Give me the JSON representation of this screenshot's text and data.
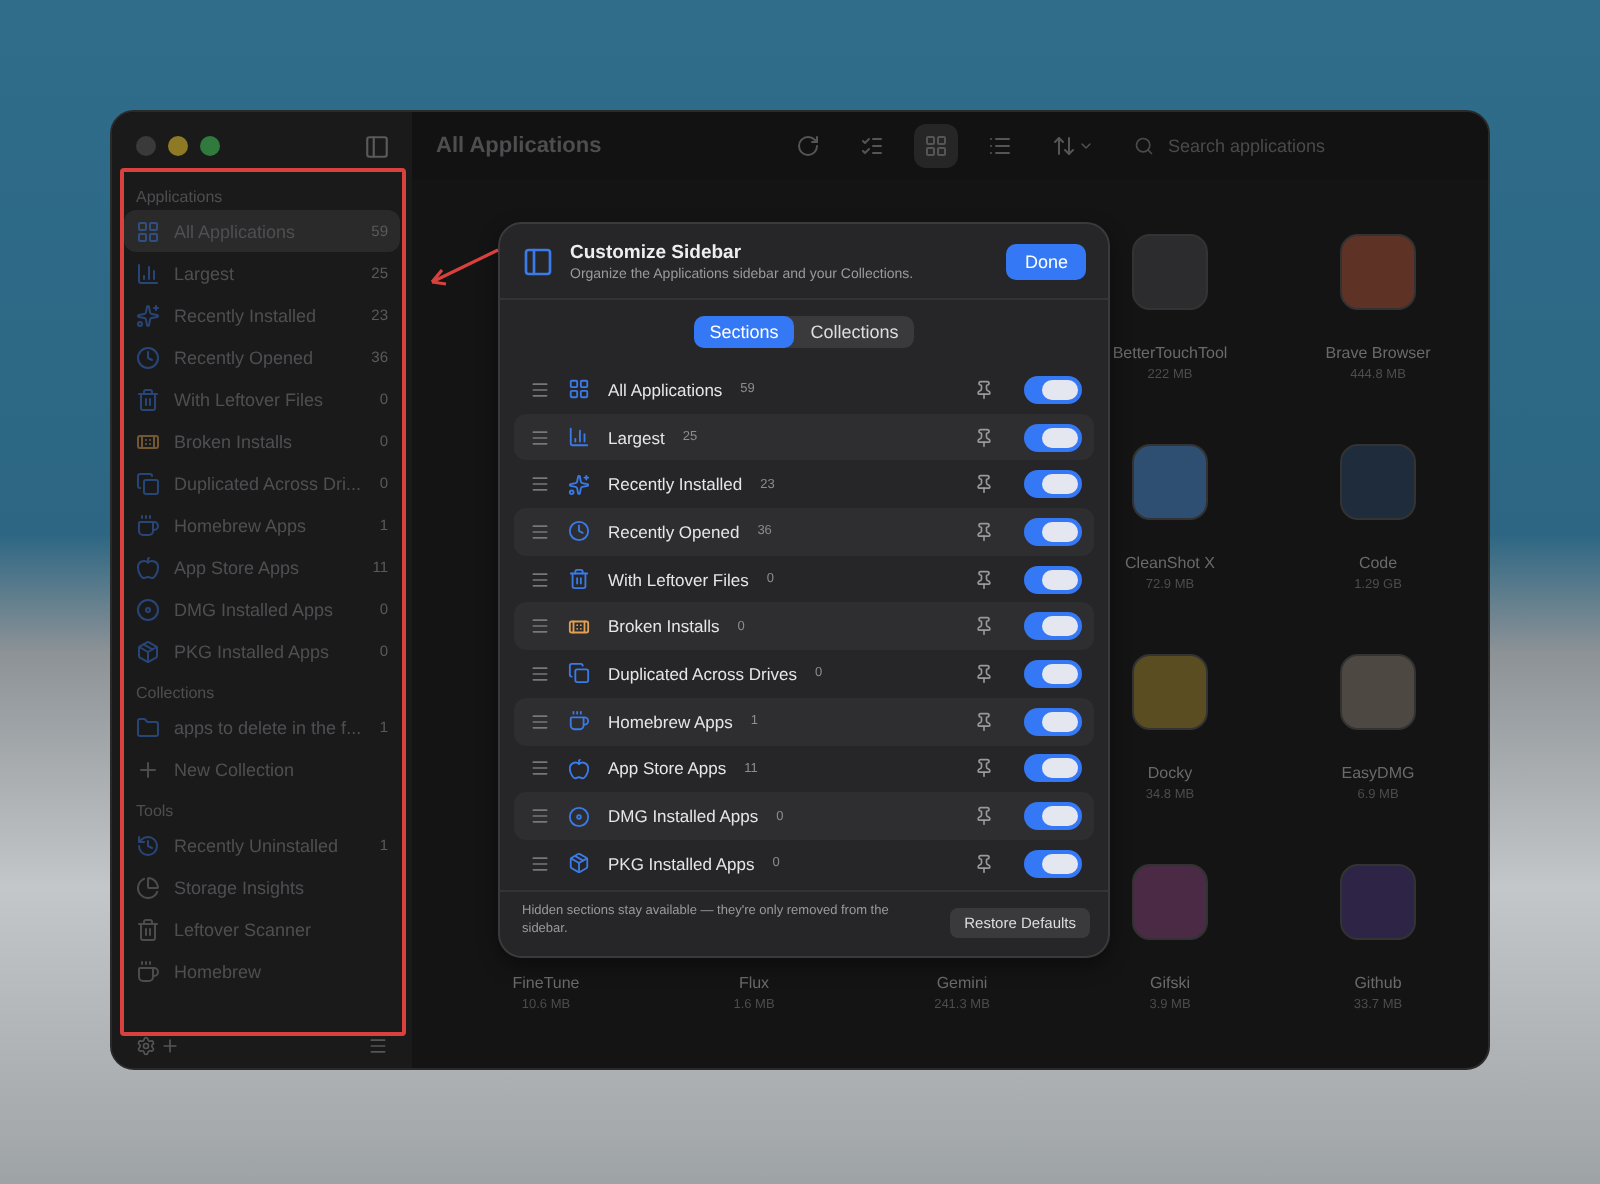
{
  "toolbar": {
    "title": "All Applications",
    "view_modes": [
      {
        "kind": "grid",
        "selected": true
      },
      {
        "kind": "list",
        "selected": false
      }
    ],
    "search": {
      "placeholder": "Search applications"
    }
  },
  "sidebar": {
    "sections": [
      {
        "heading": "Applications",
        "items": [
          {
            "label": "All Applications",
            "count": "59",
            "kind": "grid",
            "selected": true
          },
          {
            "label": "Largest",
            "count": "25",
            "kind": "bars",
            "selected": false
          },
          {
            "label": "Recently Installed",
            "count": "23",
            "kind": "sparkle",
            "selected": false
          },
          {
            "label": "Recently Opened",
            "count": "36",
            "kind": "clock",
            "selected": false
          },
          {
            "label": "With Leftover Files",
            "count": "0",
            "kind": "trash",
            "selected": false
          },
          {
            "label": "Broken Installs",
            "count": "0",
            "kind": "bandage",
            "selected": false
          },
          {
            "label": "Duplicated Across Dri...",
            "count": "0",
            "kind": "copy",
            "selected": false
          },
          {
            "label": "Homebrew Apps",
            "count": "1",
            "kind": "mug",
            "selected": false
          },
          {
            "label": "App Store Apps",
            "count": "11",
            "kind": "apple",
            "selected": false
          },
          {
            "label": "DMG Installed Apps",
            "count": "0",
            "kind": "disc",
            "selected": false
          },
          {
            "label": "PKG Installed Apps",
            "count": "0",
            "kind": "box",
            "selected": false
          }
        ]
      },
      {
        "heading": "Collections",
        "items": [
          {
            "label": "apps to delete in the f...",
            "count": "1",
            "kind": "folder",
            "selected": false
          },
          {
            "label": "New Collection",
            "kind": "plus",
            "selected": false
          }
        ]
      },
      {
        "heading": "Tools",
        "items": [
          {
            "label": "Recently Uninstalled",
            "count": "1",
            "kind": "history",
            "selected": false
          },
          {
            "label": "Storage Insights",
            "kind": "pie",
            "selected": false
          },
          {
            "label": "Leftover Scanner",
            "kind": "trash",
            "selected": false
          },
          {
            "label": "Homebrew",
            "kind": "mug",
            "selected": false
          }
        ]
      }
    ]
  },
  "app_grid": {
    "rows": [
      {
        "apps": [
          {
            "name": "BetterTouchTool",
            "size": "222 MB"
          },
          {
            "name": "Brave Browser",
            "size": "444.8 MB"
          }
        ]
      },
      {
        "apps": [
          {
            "name": "CleanShot X",
            "size": "72.9 MB"
          },
          {
            "name": "Code",
            "size": "1.29 GB"
          }
        ]
      },
      {
        "apps": [
          {
            "name": "Docky",
            "size": "34.8 MB"
          },
          {
            "name": "EasyDMG",
            "size": "6.9 MB"
          }
        ]
      },
      {
        "apps": [
          {
            "name": "FineTune",
            "size": "10.6 MB"
          },
          {
            "name": "Flux",
            "size": "1.6 MB"
          },
          {
            "name": "Gemini",
            "size": "241.3 MB"
          },
          {
            "name": "Gifski",
            "size": "3.9 MB"
          },
          {
            "name": "Github",
            "size": "33.7 MB"
          }
        ]
      }
    ]
  },
  "dialog": {
    "title": "Customize Sidebar",
    "subtitle": "Organize the Applications sidebar and your Collections.",
    "done": "Done",
    "tabs": [
      {
        "label": "Sections",
        "selected": true
      },
      {
        "label": "Collections",
        "selected": false
      }
    ],
    "rows": [
      {
        "label": "All Applications",
        "count": "59",
        "kind": "grid",
        "on": true
      },
      {
        "label": "Largest",
        "count": "25",
        "kind": "bars",
        "on": true
      },
      {
        "label": "Recently Installed",
        "count": "23",
        "kind": "sparkle",
        "on": true
      },
      {
        "label": "Recently Opened",
        "count": "36",
        "kind": "clock",
        "on": true
      },
      {
        "label": "With Leftover Files",
        "count": "0",
        "kind": "trash",
        "on": true
      },
      {
        "label": "Broken Installs",
        "count": "0",
        "kind": "bandage",
        "on": true
      },
      {
        "label": "Duplicated Across Drives",
        "count": "0",
        "kind": "copy",
        "on": true
      },
      {
        "label": "Homebrew Apps",
        "count": "1",
        "kind": "mug",
        "on": true
      },
      {
        "label": "App Store Apps",
        "count": "11",
        "kind": "apple",
        "on": true
      },
      {
        "label": "DMG Installed Apps",
        "count": "0",
        "kind": "disc",
        "on": true
      },
      {
        "label": "PKG Installed Apps",
        "count": "0",
        "kind": "box",
        "on": true
      }
    ],
    "footer_note": "Hidden sections stay available — they're only removed from the sidebar.",
    "restore": "Restore Defaults"
  }
}
